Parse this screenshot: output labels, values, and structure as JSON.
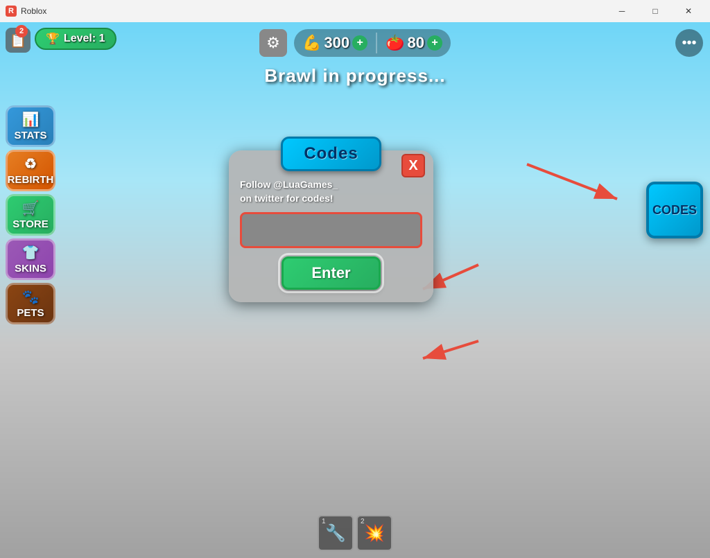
{
  "titlebar": {
    "title": "Roblox",
    "icon": "R",
    "min_label": "─",
    "max_label": "□",
    "close_label": "✕"
  },
  "hud": {
    "level_text": "Level: 1",
    "notification_count": "2",
    "brawl_text": "Brawl in progress...",
    "muscle_value": "300",
    "gem_value": "80",
    "add_label": "+",
    "settings_icon": "⚙",
    "more_icon": "···"
  },
  "sidebar": {
    "items": [
      {
        "label": "STATS",
        "icon": "📊",
        "class": "btn-stats"
      },
      {
        "label": "REBIRTH",
        "icon": "♻",
        "class": "btn-rebirth"
      },
      {
        "label": "STORE",
        "icon": "🛒",
        "class": "btn-store"
      },
      {
        "label": "SKINS",
        "icon": "👕",
        "class": "btn-skins"
      },
      {
        "label": "PETS",
        "icon": "🐾",
        "class": "btn-pets"
      }
    ]
  },
  "codes_dialog": {
    "title": "Codes",
    "close_label": "X",
    "instruction_line1": "Follow @LuaGames_",
    "instruction_line2": "on twitter for codes!",
    "input_placeholder": "",
    "enter_label": "Enter"
  },
  "codes_right_btn": {
    "label": "CODES"
  },
  "hotbar": {
    "slots": [
      {
        "number": "1",
        "icon": "🔧"
      },
      {
        "number": "2",
        "icon": "💥"
      }
    ]
  }
}
